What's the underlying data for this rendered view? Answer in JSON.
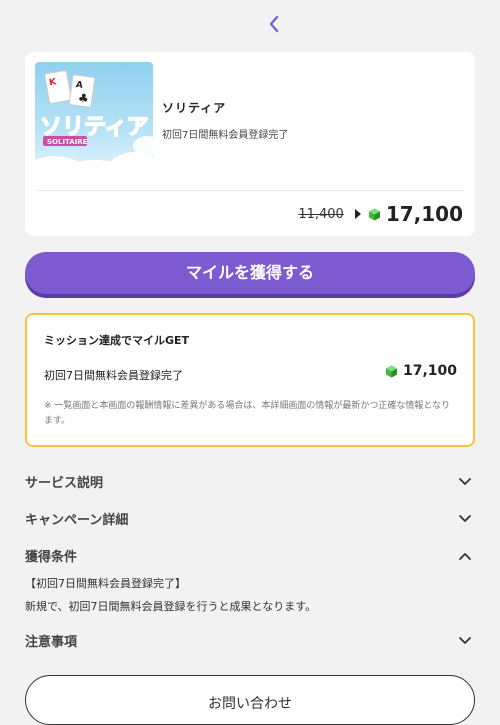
{
  "nav": {
    "back_icon": "chevron-left-icon"
  },
  "offer": {
    "image_text": "ソリティア",
    "image_subtext": "SOLITAIRE",
    "title": "ソリティア",
    "subtitle": "初回7日間無料会員登録完了",
    "old_price": "11,400",
    "new_price": "17,100",
    "gem_icon": "green-gem-icon"
  },
  "cta": {
    "label": "マイルを獲得する"
  },
  "mission": {
    "title": "ミッション達成でマイルGET",
    "item": "初回7日間無料会員登録完了",
    "points": "17,100",
    "note": "※ 一覧画面と本画面の報酬情報に差異がある場合は、本詳細画面の情報が最新かつ正確な情報となります。"
  },
  "sections": {
    "service": "サービス説明",
    "campaign": "キャンペーン詳細",
    "conditions": "獲得条件",
    "notes": "注意事項"
  },
  "conditions": {
    "line1": "【初回7日間無料会員登録完了】",
    "line2": "新規で、初回7日間無料会員登録を行うと成果となります。"
  },
  "contact": {
    "label": "お問い合わせ"
  },
  "colors": {
    "accent": "#7c5bd0",
    "mission_border": "#f2c53d",
    "gem": "#3cb83c"
  }
}
